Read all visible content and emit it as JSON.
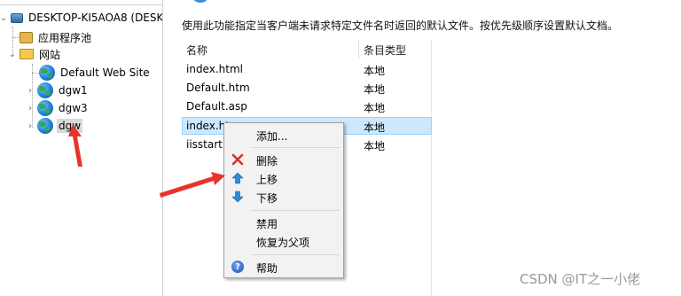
{
  "tree": {
    "server": "DESKTOP-KI5AOA8 (DESKT",
    "app_pools": "应用程序池",
    "sites": "网站",
    "site_items": [
      "Default Web Site",
      "dgw1",
      "dgw3",
      "dgw"
    ]
  },
  "main": {
    "description": "使用此功能指定当客户端未请求特定文件名时返回的默认文件。按优先级顺序设置默认文档。",
    "columns": [
      "名称",
      "条目类型"
    ],
    "rows": [
      {
        "name": "index.html",
        "type": "本地"
      },
      {
        "name": "Default.htm",
        "type": "本地"
      },
      {
        "name": "Default.asp",
        "type": "本地"
      },
      {
        "name": "index.ht",
        "type": "本地"
      },
      {
        "name": "iisstart.",
        "type": "本地"
      }
    ]
  },
  "context_menu": {
    "add": "添加...",
    "delete": "删除",
    "move_up": "上移",
    "move_down": "下移",
    "disable": "禁用",
    "revert": "恢复为父项",
    "help": "帮助"
  },
  "watermark": "CSDN @IT之一小佬",
  "colors": {
    "selection": "#cce8ff",
    "annotation": "#e8332a"
  }
}
